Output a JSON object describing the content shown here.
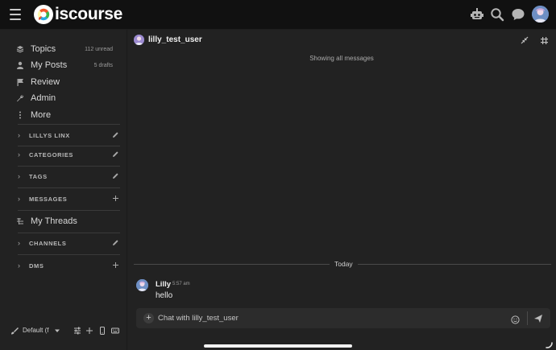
{
  "header": {
    "logo_text": "iscourse",
    "icons": [
      "hamburger-icon",
      "robot-icon",
      "search-icon",
      "chat-bubble-icon",
      "user-avatar"
    ]
  },
  "sidebar": {
    "items": [
      {
        "label": "Topics",
        "meta": "112 unread",
        "icon": "layers-icon"
      },
      {
        "label": "My Posts",
        "meta": "5 drafts",
        "icon": "user-icon"
      },
      {
        "label": "Review",
        "meta": "",
        "icon": "flag-icon"
      },
      {
        "label": "Admin",
        "meta": "",
        "icon": "wrench-icon"
      },
      {
        "label": "More",
        "meta": "",
        "icon": "more-vertical-icon"
      }
    ],
    "sections": {
      "lillys_linx": "LILLYS LINX",
      "categories": "CATEGORIES",
      "tags": "TAGS",
      "messages": "MESSAGES",
      "channels": "CHANNELS",
      "dms": "DMS"
    },
    "my_threads": "My Threads",
    "footer": {
      "theme_label": "Default (f"
    }
  },
  "channel": {
    "title": "lilly_test_user",
    "showing": "Showing all messages",
    "date_separator": "Today",
    "messages": [
      {
        "user": "Lilly",
        "time": "5:57 am",
        "text": "hello"
      }
    ],
    "composer_placeholder": "Chat with lilly_test_user"
  },
  "colors": {
    "background": "#222222",
    "header": "#111111",
    "text": "#dddddd"
  }
}
